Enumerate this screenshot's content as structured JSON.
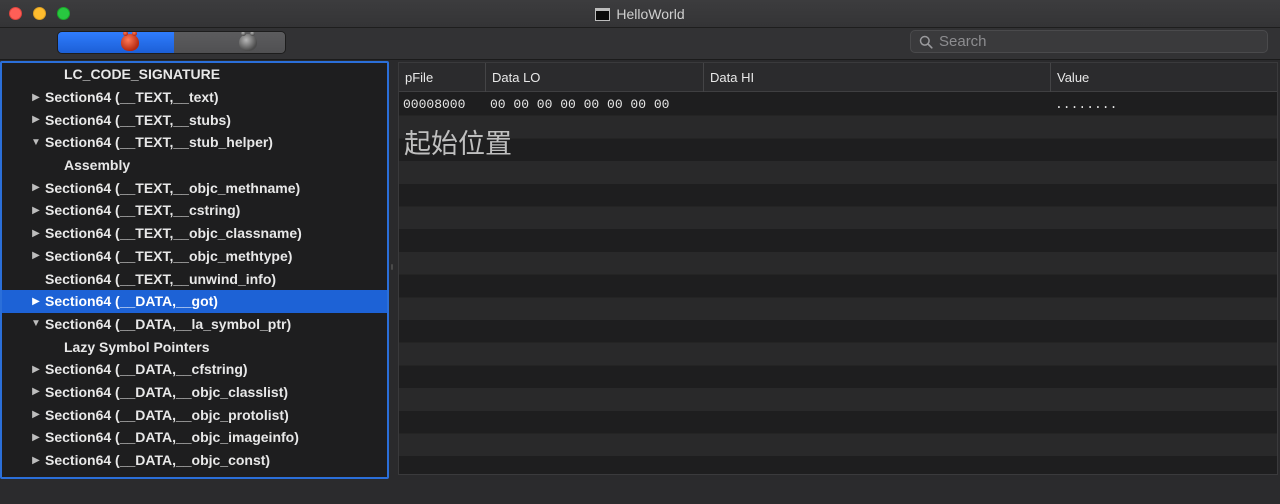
{
  "window": {
    "title": "HelloWorld"
  },
  "toolbar": {
    "segment_left_icon": "red-bug-icon",
    "segment_right_icon": "gray-bug-icon",
    "search_placeholder": "Search"
  },
  "tree": {
    "items": [
      {
        "label": "LC_CODE_SIGNATURE",
        "level": 2,
        "disclosure": ""
      },
      {
        "label": "Section64 (__TEXT,__text)",
        "level": 1,
        "disclosure": "▶"
      },
      {
        "label": "Section64 (__TEXT,__stubs)",
        "level": 1,
        "disclosure": "▶"
      },
      {
        "label": "Section64 (__TEXT,__stub_helper)",
        "level": 1,
        "disclosure": "▼"
      },
      {
        "label": "Assembly",
        "level": 2,
        "disclosure": ""
      },
      {
        "label": "Section64 (__TEXT,__objc_methname)",
        "level": 1,
        "disclosure": "▶"
      },
      {
        "label": "Section64 (__TEXT,__cstring)",
        "level": 1,
        "disclosure": "▶"
      },
      {
        "label": "Section64 (__TEXT,__objc_classname)",
        "level": 1,
        "disclosure": "▶"
      },
      {
        "label": "Section64 (__TEXT,__objc_methtype)",
        "level": 1,
        "disclosure": "▶"
      },
      {
        "label": "Section64 (__TEXT,__unwind_info)",
        "level": 1,
        "disclosure": ""
      },
      {
        "label": "Section64 (__DATA,__got)",
        "level": 1,
        "disclosure": "▶",
        "selected": true
      },
      {
        "label": "Section64 (__DATA,__la_symbol_ptr)",
        "level": 1,
        "disclosure": "▼"
      },
      {
        "label": "Lazy Symbol Pointers",
        "level": 2,
        "disclosure": ""
      },
      {
        "label": "Section64 (__DATA,__cfstring)",
        "level": 1,
        "disclosure": "▶"
      },
      {
        "label": "Section64 (__DATA,__objc_classlist)",
        "level": 1,
        "disclosure": "▶"
      },
      {
        "label": "Section64 (__DATA,__objc_protolist)",
        "level": 1,
        "disclosure": "▶"
      },
      {
        "label": "Section64 (__DATA,__objc_imageinfo)",
        "level": 1,
        "disclosure": "▶"
      },
      {
        "label": "Section64 (__DATA,__objc_const)",
        "level": 1,
        "disclosure": "▶"
      }
    ]
  },
  "table": {
    "columns": [
      "pFile",
      "Data LO",
      "Data HI",
      "Value"
    ],
    "rows": [
      [
        "00008000",
        "00 00 00 00 00 00 00 00",
        "",
        "........"
      ]
    ],
    "annotation": "起始位置"
  },
  "colors": {
    "accent": "#1d62d6",
    "panel_border": "#2b6fd9",
    "background": "#1e1e1f"
  }
}
